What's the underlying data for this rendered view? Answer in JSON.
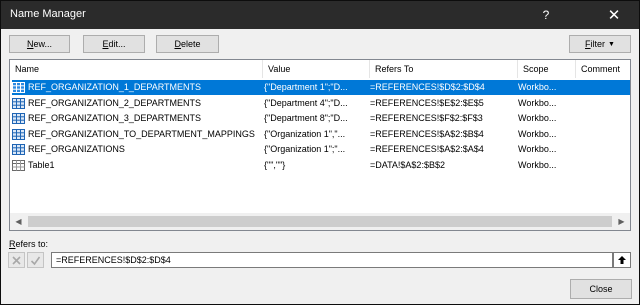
{
  "window": {
    "title": "Name Manager",
    "help_glyph": "?",
    "close_glyph": "✕"
  },
  "toolbar": {
    "new_key": "N",
    "new_rest": "ew...",
    "edit_key": "E",
    "edit_rest": "dit...",
    "delete_key": "D",
    "delete_rest": "elete",
    "filter_key": "F",
    "filter_rest": "ilter"
  },
  "columns": {
    "name": "Name",
    "value": "Value",
    "refers_to": "Refers To",
    "scope": "Scope",
    "comment": "Comment"
  },
  "rows": [
    {
      "icon": "named-range-icon",
      "name": "REF_ORGANIZATION_1_DEPARTMENTS",
      "value": "{\"Department 1\";\"D...",
      "refers_to": "=REFERENCES!$D$2:$D$4",
      "scope": "Workbo...",
      "comment": "",
      "selected": true
    },
    {
      "icon": "named-range-icon",
      "name": "REF_ORGANIZATION_2_DEPARTMENTS",
      "value": "{\"Department 4\";\"D...",
      "refers_to": "=REFERENCES!$E$2:$E$5",
      "scope": "Workbo...",
      "comment": "",
      "selected": false
    },
    {
      "icon": "named-range-icon",
      "name": "REF_ORGANIZATION_3_DEPARTMENTS",
      "value": "{\"Department 8\";\"D...",
      "refers_to": "=REFERENCES!$F$2:$F$3",
      "scope": "Workbo...",
      "comment": "",
      "selected": false
    },
    {
      "icon": "named-range-icon",
      "name": "REF_ORGANIZATION_TO_DEPARTMENT_MAPPINGS",
      "value": "{\"Organization 1\",\"...",
      "refers_to": "=REFERENCES!$A$2:$B$4",
      "scope": "Workbo...",
      "comment": "",
      "selected": false
    },
    {
      "icon": "named-range-icon",
      "name": "REF_ORGANIZATIONS",
      "value": "{\"Organization 1\";\"...",
      "refers_to": "=REFERENCES!$A$2:$A$4",
      "scope": "Workbo...",
      "comment": "",
      "selected": false
    },
    {
      "icon": "table-icon",
      "name": "Table1",
      "value": "{\"\",\"\"}",
      "refers_to": "=DATA!$A$2:$B$2",
      "scope": "Workbo...",
      "comment": "",
      "selected": false
    }
  ],
  "refers_to": {
    "label_key": "R",
    "label_rest": "efers to:",
    "value": "=REFERENCES!$D$2:$D$4"
  },
  "footer": {
    "close_label": "Close"
  },
  "colors": {
    "selection": "#0078d7",
    "titlebar": "#2b2b2b"
  }
}
